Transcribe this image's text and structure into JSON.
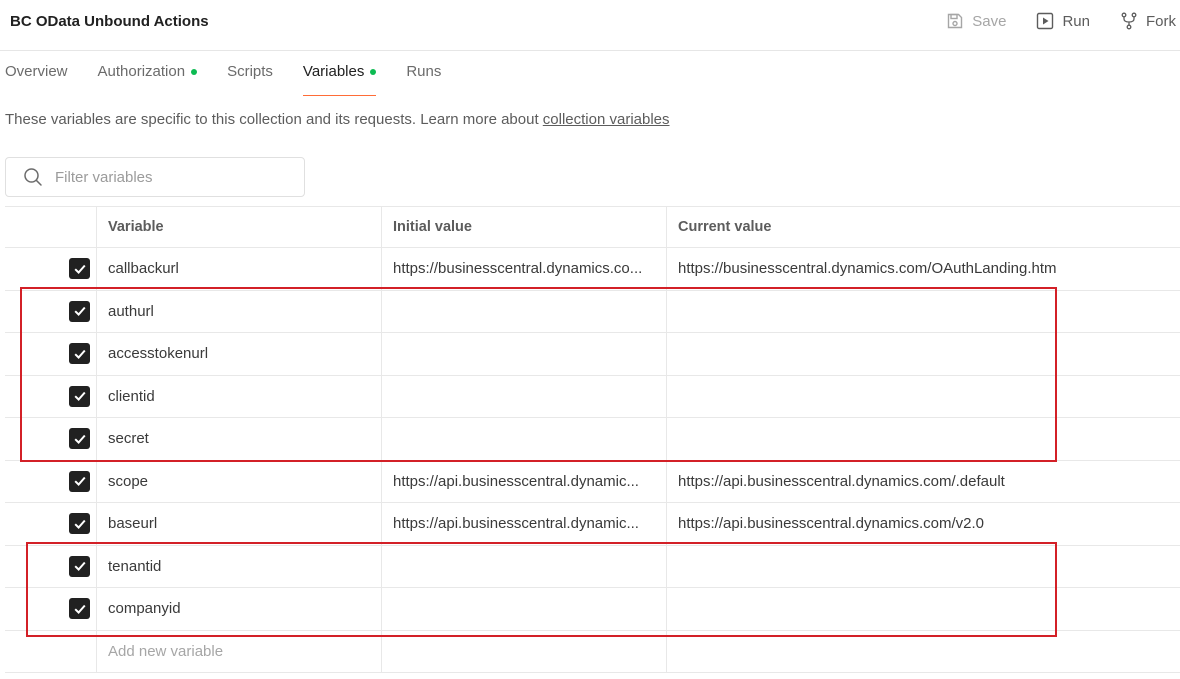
{
  "header": {
    "title": "BC OData Unbound Actions",
    "save_label": "Save",
    "run_label": "Run",
    "fork_label": "Fork"
  },
  "tabs": [
    {
      "label": "Overview",
      "dot": false
    },
    {
      "label": "Authorization",
      "dot": true
    },
    {
      "label": "Scripts",
      "dot": false
    },
    {
      "label": "Variables",
      "dot": true,
      "active": true
    },
    {
      "label": "Runs",
      "dot": false
    }
  ],
  "description": {
    "text": "These variables are specific to this collection and its requests. Learn more about ",
    "link": "collection variables"
  },
  "filter": {
    "placeholder": "Filter variables"
  },
  "table": {
    "columns": [
      "Variable",
      "Initial value",
      "Current value"
    ],
    "rows": [
      {
        "checked": true,
        "variable": "callbackurl",
        "initial": "https://businesscentral.dynamics.co...",
        "current": "https://businesscentral.dynamics.com/OAuthLanding.htm"
      },
      {
        "checked": true,
        "variable": "authurl",
        "initial": "",
        "current": ""
      },
      {
        "checked": true,
        "variable": "accesstokenurl",
        "initial": "",
        "current": ""
      },
      {
        "checked": true,
        "variable": "clientid",
        "initial": "",
        "current": ""
      },
      {
        "checked": true,
        "variable": "secret",
        "initial": "",
        "current": ""
      },
      {
        "checked": true,
        "variable": "scope",
        "initial": "https://api.businesscentral.dynamic...",
        "current": "https://api.businesscentral.dynamics.com/.default"
      },
      {
        "checked": true,
        "variable": "baseurl",
        "initial": "https://api.businesscentral.dynamic...",
        "current": "https://api.businesscentral.dynamics.com/v2.0"
      },
      {
        "checked": true,
        "variable": "tenantid",
        "initial": "",
        "current": ""
      },
      {
        "checked": true,
        "variable": "companyid",
        "initial": "",
        "current": ""
      }
    ],
    "add_placeholder": "Add new variable"
  },
  "colors": {
    "accent": "#ff6c37",
    "status_dot": "#0cbb52",
    "highlight": "#d32027"
  }
}
